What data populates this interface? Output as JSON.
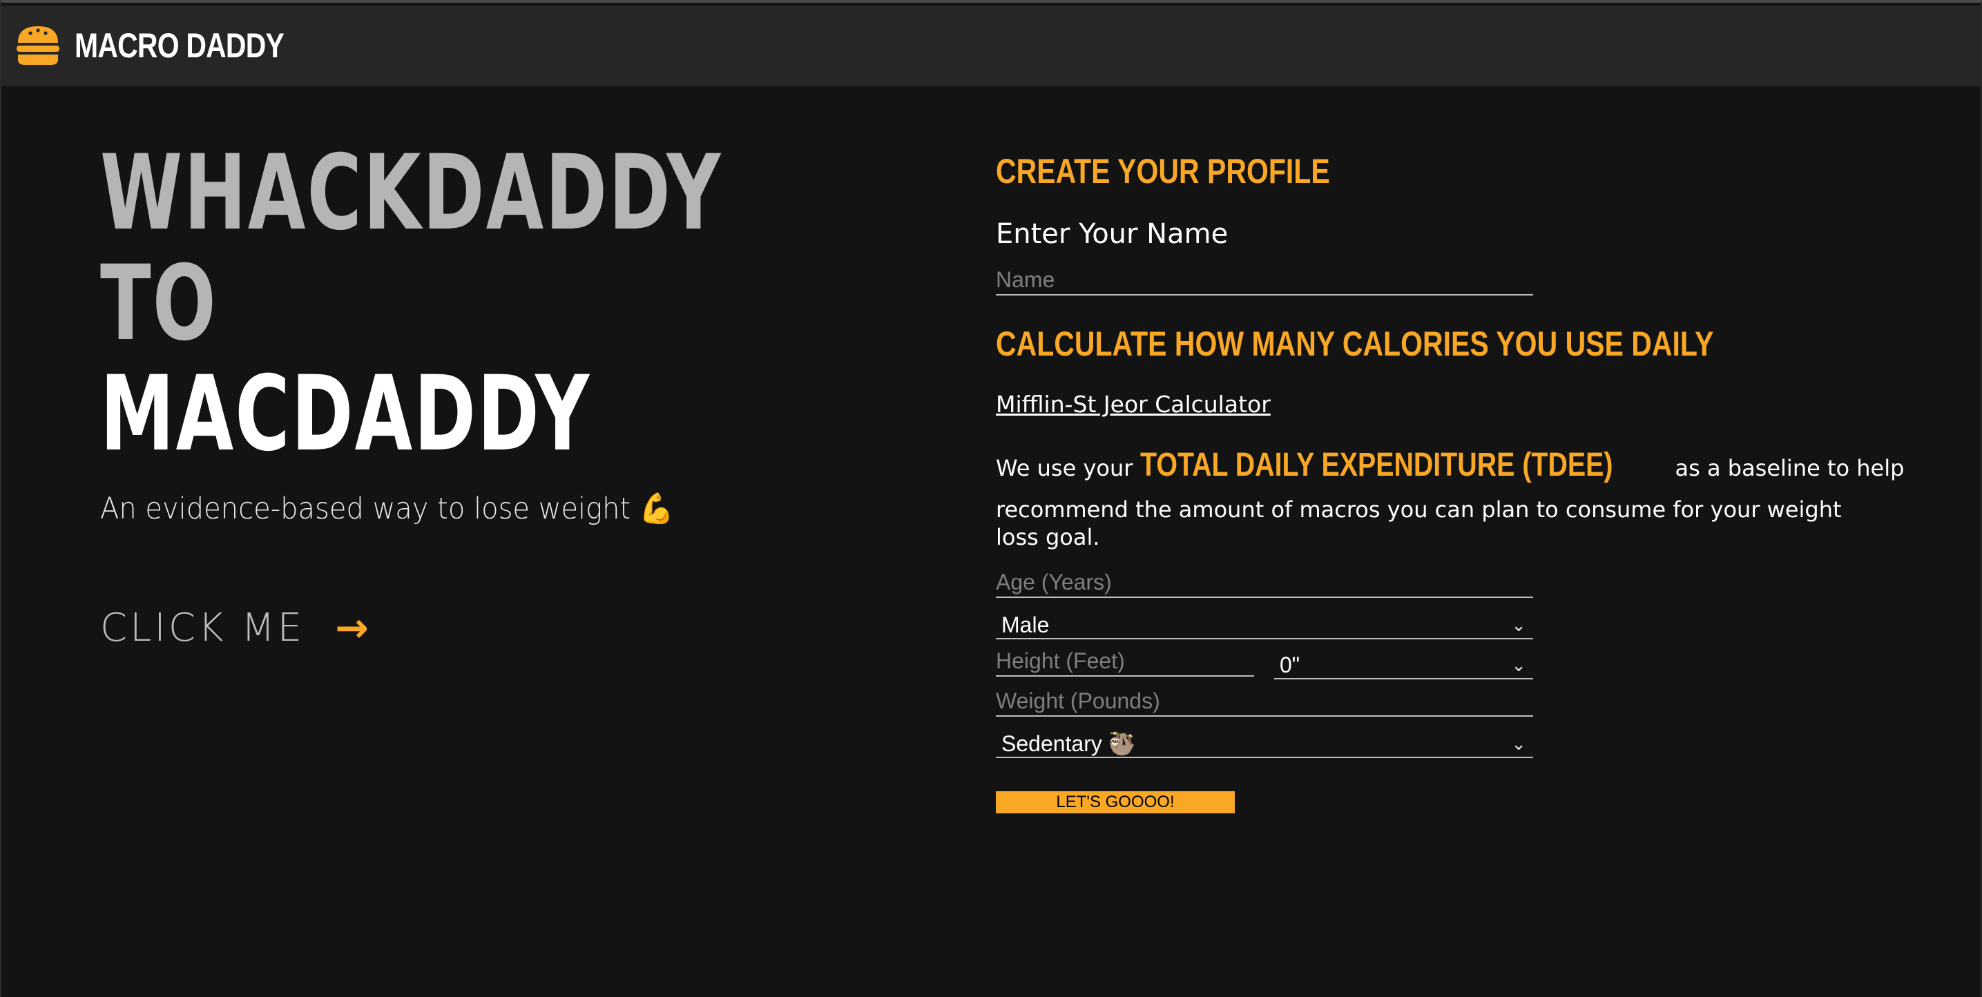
{
  "brand": {
    "name": "MACRO DADDY",
    "accent": "#f9a826"
  },
  "hero": {
    "line1": "WHACKDADDY",
    "line2": "TO",
    "line3": "MACDADDY",
    "subtitle": "An evidence-based way to lose weight 💪",
    "cta_label": "CLICK ME",
    "cta_arrow": "→"
  },
  "profile": {
    "heading": "CREATE YOUR PROFILE",
    "name_label": "Enter Your Name",
    "name_placeholder": "Name"
  },
  "calculator": {
    "heading": "CALCULATE HOW MANY CALORIES YOU USE DAILY",
    "link_label": "Mifflin-St Jeor Calculator",
    "para_prefix": "We use your",
    "para_highlight": "TOTAL DAILY EXPENDITURE (TDEE)",
    "para_suffix": "as a baseline to help",
    "para_rest": "recommend the amount of macros you can plan to consume for your weight loss goal.",
    "age_placeholder": "Age (Years)",
    "sex_value": "Male",
    "height_placeholder": "Height (Feet)",
    "inches_value": "0\"",
    "weight_placeholder": "Weight (Pounds)",
    "activity_value": "Sedentary 🦥",
    "submit_label": "LET'S GOOOO!"
  }
}
